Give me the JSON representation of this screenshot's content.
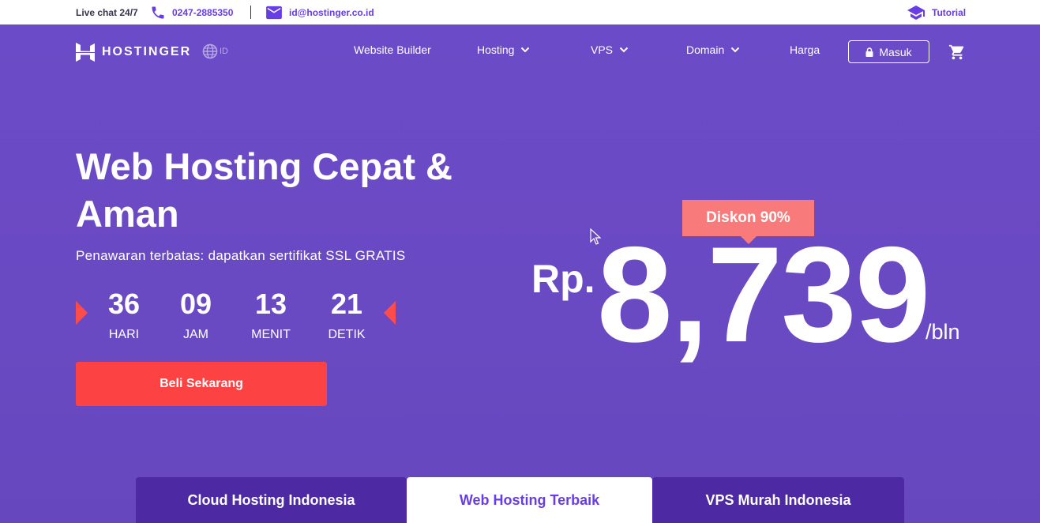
{
  "topbar": {
    "livechat": "Live chat 24/7",
    "phone": "0247-2885350",
    "email": "id@hostinger.co.id",
    "tutorial": "Tutorial"
  },
  "nav": {
    "logo": "HOSTINGER",
    "lang": "ID",
    "links": [
      "Website Builder",
      "Hosting",
      "VPS",
      "Domain",
      "Harga"
    ],
    "login": "Masuk"
  },
  "hero": {
    "title": "Web Hosting Cepat & Aman",
    "subtitle": "Penawaran terbatas: dapatkan sertifikat SSL GRATIS",
    "countdown": [
      {
        "value": "36",
        "label": "HARI"
      },
      {
        "value": "09",
        "label": "JAM"
      },
      {
        "value": "13",
        "label": "MENIT"
      },
      {
        "value": "21",
        "label": "DETIK"
      }
    ],
    "cta": "Beli Sekarang",
    "discount": "Diskon 90%",
    "currency": "Rp.",
    "price": "8,739",
    "period": "/bln"
  },
  "tabs": [
    "Cloud Hosting Indonesia",
    "Web Hosting Terbaik",
    "VPS Murah Indonesia"
  ],
  "colors": {
    "brand": "#673de6",
    "cta": "#fc4242",
    "discount": "#f87a7a",
    "tab_dark": "#4d2aa3"
  }
}
